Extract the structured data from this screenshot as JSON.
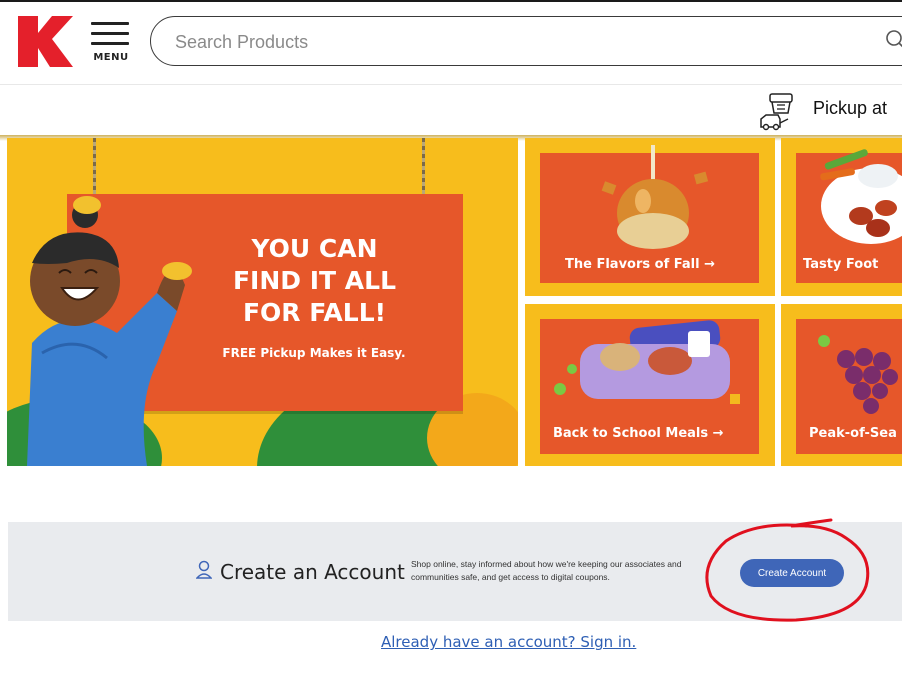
{
  "header": {
    "logo_icon": "kroger-k-logo",
    "menu_label": "MENU",
    "search_placeholder": "Search Products",
    "pickup_text": "Pickup at"
  },
  "hero": {
    "title": "YOU CAN\nFIND IT ALL\nFOR FALL!",
    "subtitle": "FREE Pickup Makes it Easy."
  },
  "tiles": [
    {
      "label": "The Flavors of Fall →"
    },
    {
      "label": "Tasty Foot"
    },
    {
      "label": "Back to School Meals →"
    },
    {
      "label": "Peak-of-Sea"
    }
  ],
  "account": {
    "title": "Create an Account",
    "description": "Shop online, stay informed about how we're keeping our associates and communities safe, and get access to digital coupons.",
    "button_label": "Create Account",
    "signin_link": "Already have an account? Sign in."
  },
  "colors": {
    "brand_red": "#e4202b",
    "promo_yellow": "#f7bd1c",
    "promo_orange": "#e6572a",
    "button_blue": "#3f66b8",
    "link_blue": "#2e5fb4",
    "annotation_red": "#e0101e"
  }
}
